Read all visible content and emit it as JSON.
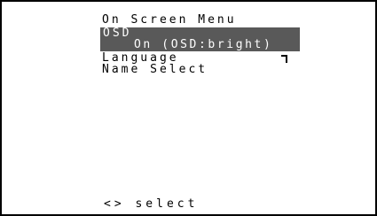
{
  "menu": {
    "title": "On Screen Menu",
    "items": [
      {
        "label": "OSD",
        "value": "On (OSD:bright)",
        "selected": true
      },
      {
        "label": "Language"
      },
      {
        "label": "Name Select"
      }
    ]
  },
  "footer": {
    "hint": "<> select"
  },
  "colors": {
    "highlight": "#595959",
    "text": "#000000",
    "highlight_text": "#ffffff",
    "background": "#ffffff"
  }
}
